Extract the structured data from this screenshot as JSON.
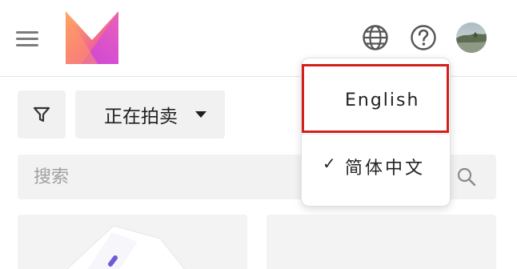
{
  "header": {
    "menu_icon": "hamburger-menu-icon",
    "logo_icon": "brand-logo-icon",
    "language_icon": "globe-icon",
    "help_icon": "help-circle-icon",
    "avatar_icon": "user-avatar"
  },
  "filters": {
    "filter_icon": "filter-funnel-icon",
    "status_select": "正在拍卖"
  },
  "search": {
    "placeholder": "搜索",
    "icon": "search-icon"
  },
  "language_menu": {
    "items": [
      {
        "label": "English",
        "selected": false
      },
      {
        "label": "简体中文",
        "selected": true,
        "check": "✓"
      }
    ],
    "highlight_color": "#d3201b"
  },
  "colors": {
    "logo_gradient_start": "#ffb15a",
    "logo_gradient_end": "#e94bd6",
    "accent_highlight": "#d3201b"
  }
}
